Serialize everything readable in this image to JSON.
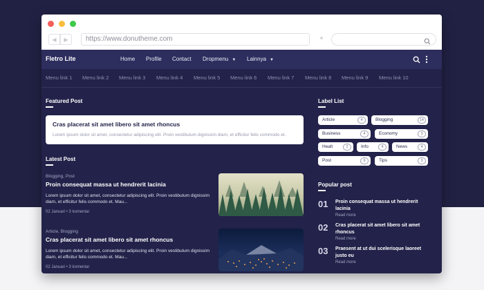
{
  "browser": {
    "url": "https://www.donutheme.com",
    "controls": {
      "back_icon": "chevron-left-icon",
      "forward_icon": "chevron-right-icon",
      "search_icon": "search-icon"
    }
  },
  "navbar": {
    "brand": "Fletro Lite",
    "items": [
      {
        "label": "Home"
      },
      {
        "label": "Profile"
      },
      {
        "label": "Contact"
      },
      {
        "label": "Dropmenu",
        "has_dropdown": true
      },
      {
        "label": "Lainnya",
        "has_dropdown": true
      }
    ],
    "icons": [
      "search-icon",
      "more-vertical-icon"
    ]
  },
  "subnav": {
    "links": [
      "Menu link 1",
      "Menu link 2",
      "Menu link 3",
      "Menu link 4",
      "Menu link 5",
      "Menu link 6",
      "Menu link 7",
      "Menu link 8",
      "Menu link 9",
      "Menu link 10"
    ]
  },
  "featured": {
    "heading": "Featured Post",
    "title": "Cras placerat sit amet libero sit amet rhoncus",
    "excerpt": "Lorem ipsum dolor sit amet, consectetur adipiscing elit. Proin vestibulum dignissim diam, et efficitur felis commodo et."
  },
  "latest": {
    "heading": "Latest Post",
    "posts": [
      {
        "categories": "Blogging, Post",
        "title": "Proin consequat massa ut hendrerit lacinia",
        "excerpt": "Lorem ipsum dolor sit amet, consectetur adipiscing elit. Proin vestibulum dignissim diam, et efficitur felis commodo et. Mau...",
        "date": "02 Januari",
        "comments": "3 komentar",
        "image": "misty-forest"
      },
      {
        "categories": "Article, Blogging",
        "title": "Cras placerat sit amet libero sit amet rhoncus",
        "excerpt": "Lorem ipsum dolor sit amet, consectetur adipiscing elit. Proin vestibulum dignissim diam, et efficitur felis commodo et. Mau...",
        "date": "02 Januari",
        "comments": "3 komentar",
        "image": "night-town"
      }
    ]
  },
  "labels": {
    "heading": "Label List",
    "items": [
      {
        "name": "Article",
        "count": "4"
      },
      {
        "name": "Blogging",
        "count": "14"
      },
      {
        "name": "Business",
        "count": "4"
      },
      {
        "name": "Economy",
        "count": "3"
      },
      {
        "name": "Healt",
        "count": "2"
      },
      {
        "name": "Info",
        "count": "4"
      },
      {
        "name": "News",
        "count": "4"
      },
      {
        "name": "Post",
        "count": "9"
      },
      {
        "name": "Tips",
        "count": "3"
      }
    ]
  },
  "popular": {
    "heading": "Popular post",
    "read_more": "Read more",
    "items": [
      {
        "num": "01",
        "title": "Proin consequat massa ut hendrerit lacinia"
      },
      {
        "num": "02",
        "title": "Cras placerat sit amet libero sit amet rhoncus"
      },
      {
        "num": "03",
        "title": "Praesent at ut dui scelerisque laoreet justo eu"
      }
    ]
  },
  "colors": {
    "page_dark": "#212144",
    "window_bg": "#22224a",
    "nav_bg": "#2d2d5e",
    "text_muted": "#8f91b2"
  }
}
